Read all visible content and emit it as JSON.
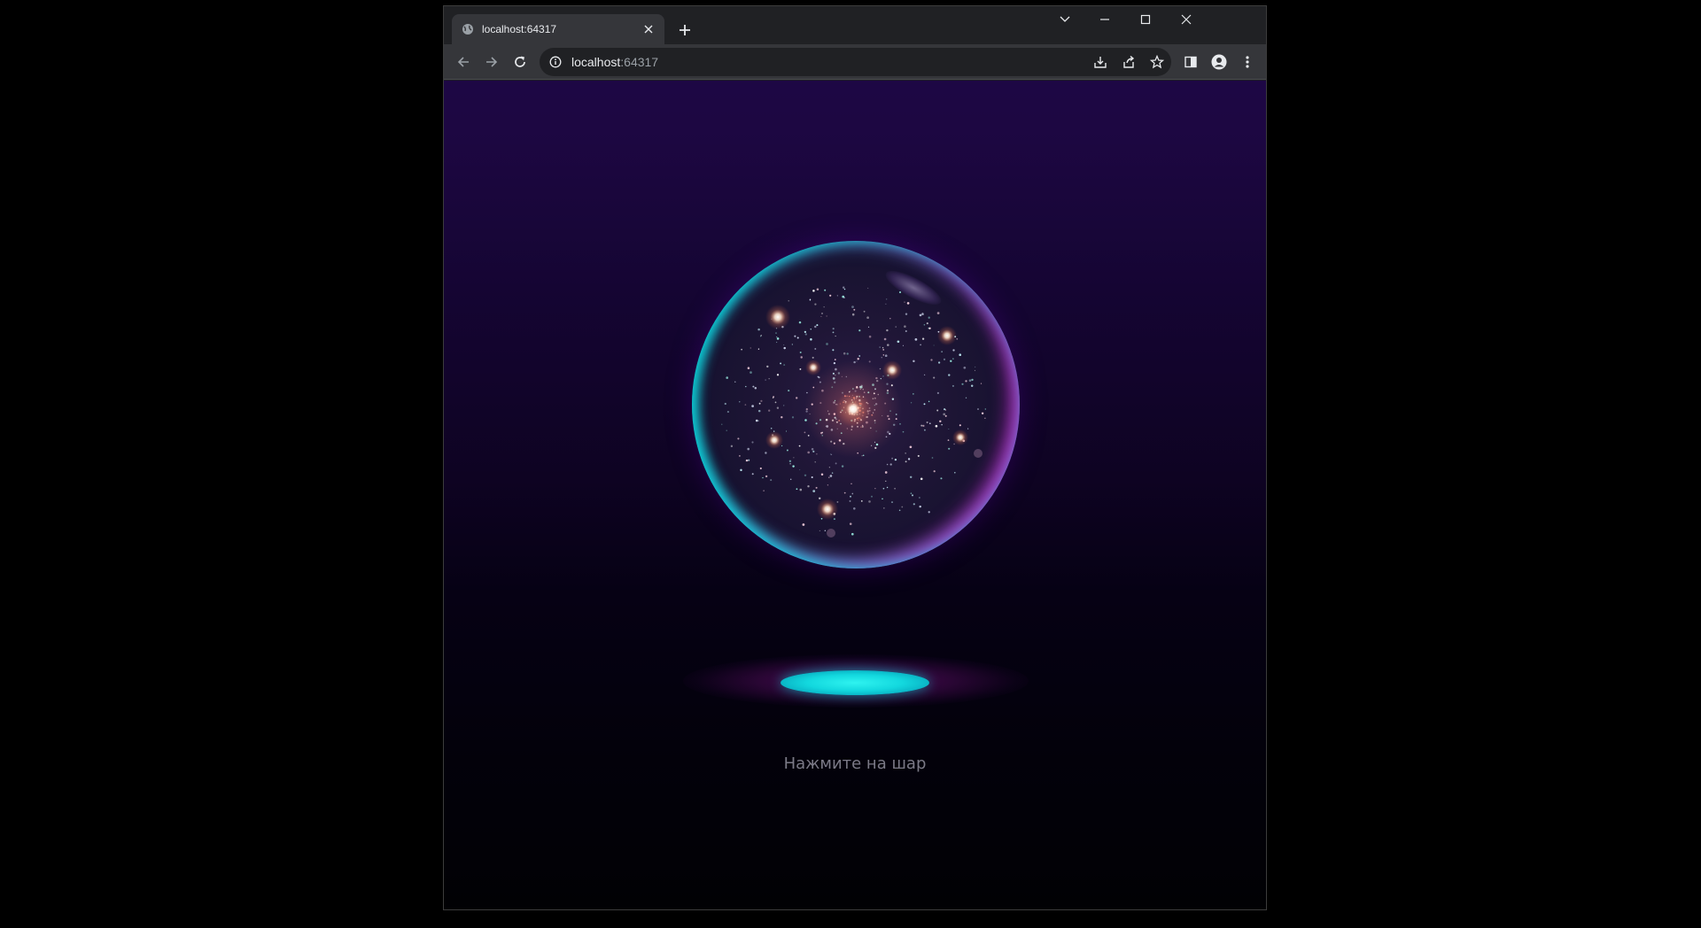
{
  "browser": {
    "tab": {
      "title": "localhost:64317",
      "favicon": "globe-icon"
    },
    "address_bar": {
      "host": "localhost",
      "port": ":64317",
      "info_icon": "info-icon"
    },
    "toolbar_icons": [
      "back-icon",
      "forward-icon",
      "reload-icon",
      "install-icon",
      "share-icon",
      "star-icon",
      "side-panel-icon",
      "profile-icon",
      "menu-icon"
    ],
    "window_controls": [
      "tab-search-icon",
      "minimize-icon",
      "maximize-icon",
      "close-icon"
    ]
  },
  "page": {
    "hint_text": "Нажмите на шар",
    "colors": {
      "background_top": "#1d0744",
      "background_bottom": "#010104",
      "orb_rim_cyan": "#00dcdc",
      "orb_rim_magenta": "#d228d2",
      "shadow_cyan": "#2ff3f0",
      "hint_text": "#7b7a86"
    }
  }
}
